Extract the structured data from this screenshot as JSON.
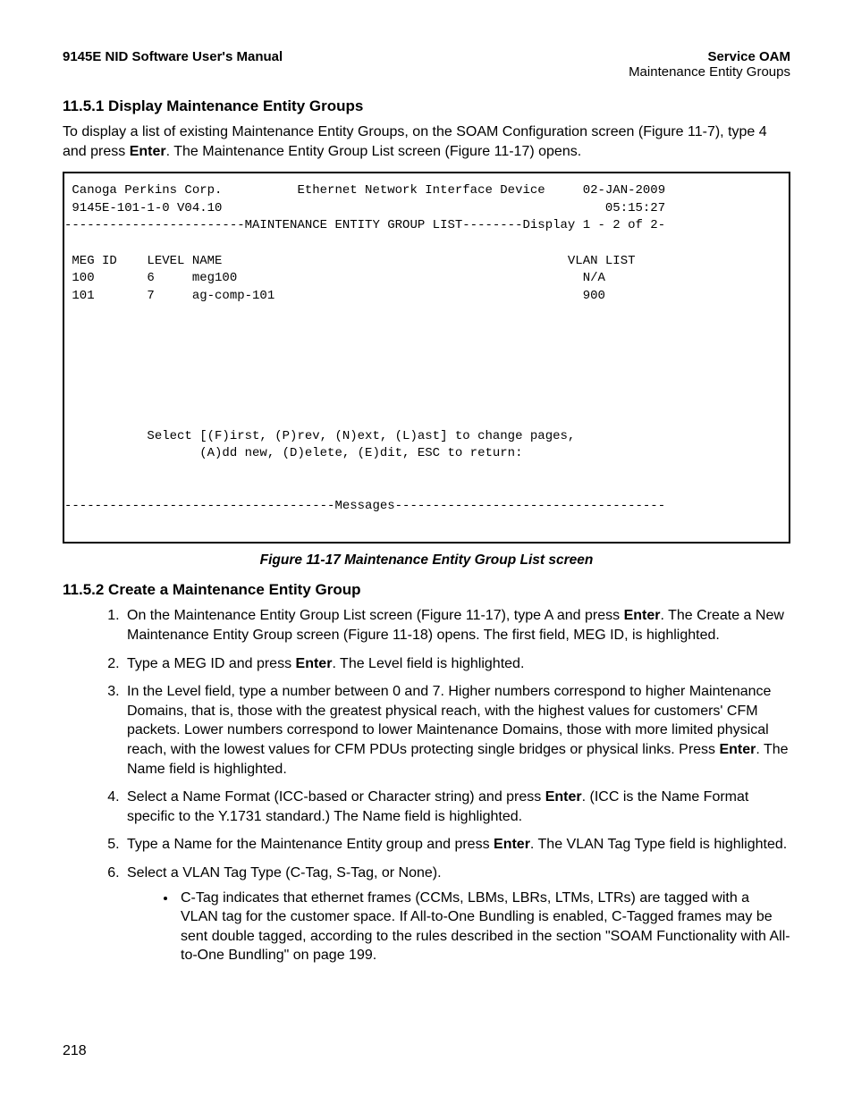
{
  "header": {
    "left": "9145E NID Software User's Manual",
    "right_bold": "Service OAM",
    "right_sub": "Maintenance Entity Groups"
  },
  "section1": {
    "heading": "11.5.1  Display Maintenance Entity Groups",
    "para_a": "To display a list of existing Maintenance Entity Groups, on the SOAM Configuration screen (Figure 11-7), type 4 and press ",
    "para_bold": "Enter",
    "para_b": ". The Maintenance Entity Group List screen (Figure 11-17) opens."
  },
  "terminal": {
    "line1": " Canoga Perkins Corp.          Ethernet Network Interface Device     02-JAN-2009",
    "line2": " 9145E-101-1-0 V04.10                                                   05:15:27",
    "line3": "------------------------MAINTENANCE ENTITY GROUP LIST--------Display 1 - 2 of 2-",
    "line4": " ",
    "line5": " MEG ID    LEVEL NAME                                              VLAN LIST",
    "line6": " 100       6     meg100                                              N/A",
    "line7": " 101       7     ag-comp-101                                         900",
    "blank": " ",
    "line11": "           Select [(F)irst, (P)rev, (N)ext, (L)ast] to change pages,",
    "line12": "                  (A)dd new, (D)elete, (E)dit, ESC to return:",
    "line13": "------------------------------------Messages------------------------------------"
  },
  "figure_caption": "Figure 11-17  Maintenance Entity Group List screen",
  "section2": {
    "heading": "11.5.2  Create a Maintenance Entity Group",
    "step1_a": "On the Maintenance Entity Group List screen (Figure 11-17), type A and press ",
    "step1_bold": "Enter",
    "step1_b": ". The Create a New Maintenance Entity Group screen (Figure 11-18) opens. The first field, MEG ID, is highlighted.",
    "step2_a": "Type a MEG ID and press ",
    "step2_bold": "Enter",
    "step2_b": ". The Level field is highlighted.",
    "step3_a": "In the Level field, type a number between 0 and 7. Higher numbers correspond to higher Maintenance Domains, that is, those with the greatest physical reach, with the highest values for customers' CFM packets. Lower numbers correspond to lower Maintenance Domains, those with more limited physical reach, with the lowest values for CFM PDUs protecting single bridges or physical links. Press ",
    "step3_bold": "Enter",
    "step3_b": ". The Name field is highlighted.",
    "step4_a": "Select a Name Format (ICC-based or Character string) and press ",
    "step4_bold": "Enter",
    "step4_b": ". (ICC is the Name Format specific to the Y.1731 standard.) The Name field is highlighted.",
    "step5_a": "Type a Name for the Maintenance Entity group and press ",
    "step5_bold": "Enter",
    "step5_b": ". The VLAN Tag Type field is highlighted.",
    "step6_a": "Select a VLAN Tag Type (C-Tag, S-Tag, or None).",
    "bullet1": "C-Tag indicates that ethernet frames (CCMs, LBMs, LBRs, LTMs, LTRs) are tagged with a VLAN tag for the customer space. If All-to-One Bundling is enabled, C-Tagged frames may be sent double tagged, according to the rules described in the section \"SOAM Functionality with All-to-One Bundling\" on page 199."
  },
  "page_number": "218"
}
